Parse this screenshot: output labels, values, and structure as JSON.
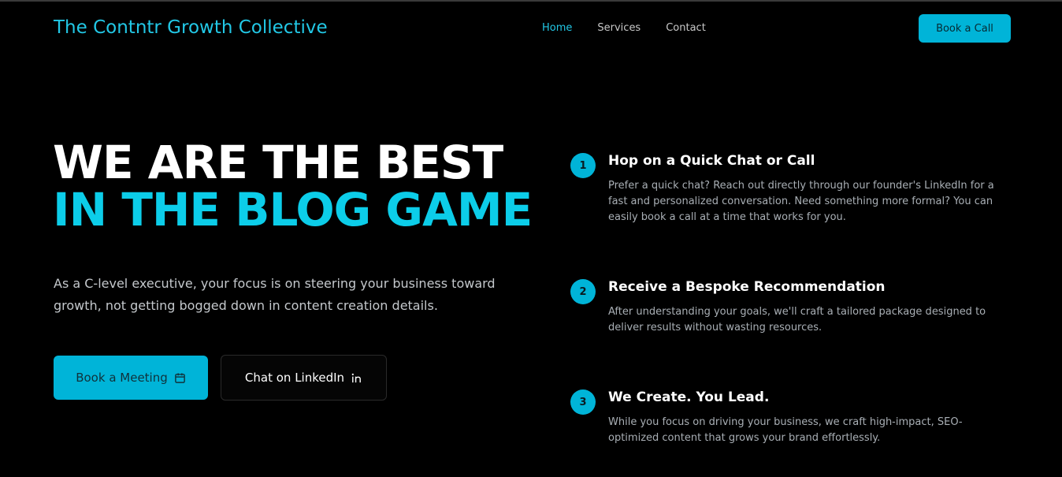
{
  "header": {
    "brand": "The Contntr Growth Collective",
    "nav": [
      {
        "label": "Home",
        "active": true
      },
      {
        "label": "Services",
        "active": false
      },
      {
        "label": "Contact",
        "active": false
      }
    ],
    "cta_label": "Book a Call"
  },
  "hero": {
    "title_line1": "WE ARE THE BEST",
    "title_line2": "IN THE BLOG GAME",
    "subtitle": "As a C-level executive, your focus is on steering your business toward growth, not getting bogged down in content creation details.",
    "primary_button": {
      "label": "Book a Meeting",
      "icon": "calendar-icon"
    },
    "secondary_button": {
      "label": "Chat on LinkedIn",
      "icon": "linkedin-icon"
    }
  },
  "steps": [
    {
      "number": "1",
      "title": "Hop on a Quick Chat or Call",
      "description": "Prefer a quick chat? Reach out directly through our founder's LinkedIn for a fast and personalized conversation. Need something more formal? You can easily book a call at a time that works for you."
    },
    {
      "number": "2",
      "title": "Receive a Bespoke Recommendation",
      "description": "After understanding your goals, we'll craft a tailored package designed to deliver results without wasting resources."
    },
    {
      "number": "3",
      "title": "We Create. You Lead.",
      "description": "While you focus on driving your business, we craft high-impact, SEO-optimized content that grows your brand effortlessly."
    }
  ],
  "colors": {
    "accent": "#00b4d8",
    "accent_text": "#22c8e6",
    "background": "#000000"
  }
}
